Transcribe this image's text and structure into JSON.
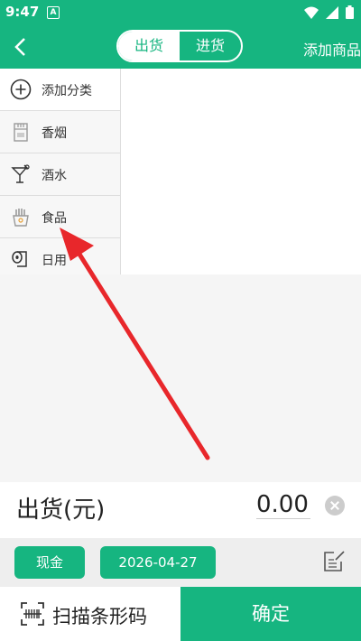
{
  "status_bar": {
    "time": "9:47",
    "notification_badge": "A"
  },
  "header": {
    "back_icon": "chevron-left-icon",
    "tabs": [
      {
        "label": "出货",
        "active": true
      },
      {
        "label": "进货",
        "active": false
      }
    ],
    "add_goods_label": "添加商品"
  },
  "categories": [
    {
      "label": "添加分类",
      "icon": "plus-circle-icon"
    },
    {
      "label": "香烟",
      "icon": "cigarette-box-icon"
    },
    {
      "label": "酒水",
      "icon": "cocktail-glass-icon"
    },
    {
      "label": "食品",
      "icon": "fries-box-icon"
    },
    {
      "label": "日用",
      "icon": "toilet-roll-icon"
    }
  ],
  "summary": {
    "label": "出货(元)",
    "amount": "0.00"
  },
  "options": {
    "payment": "现金",
    "date": "2026-04-27"
  },
  "bottom_bar": {
    "scan_label": "扫描条形码",
    "confirm_label": "确定"
  },
  "colors": {
    "accent": "#16b580",
    "annotation_arrow": "#e8272b"
  }
}
